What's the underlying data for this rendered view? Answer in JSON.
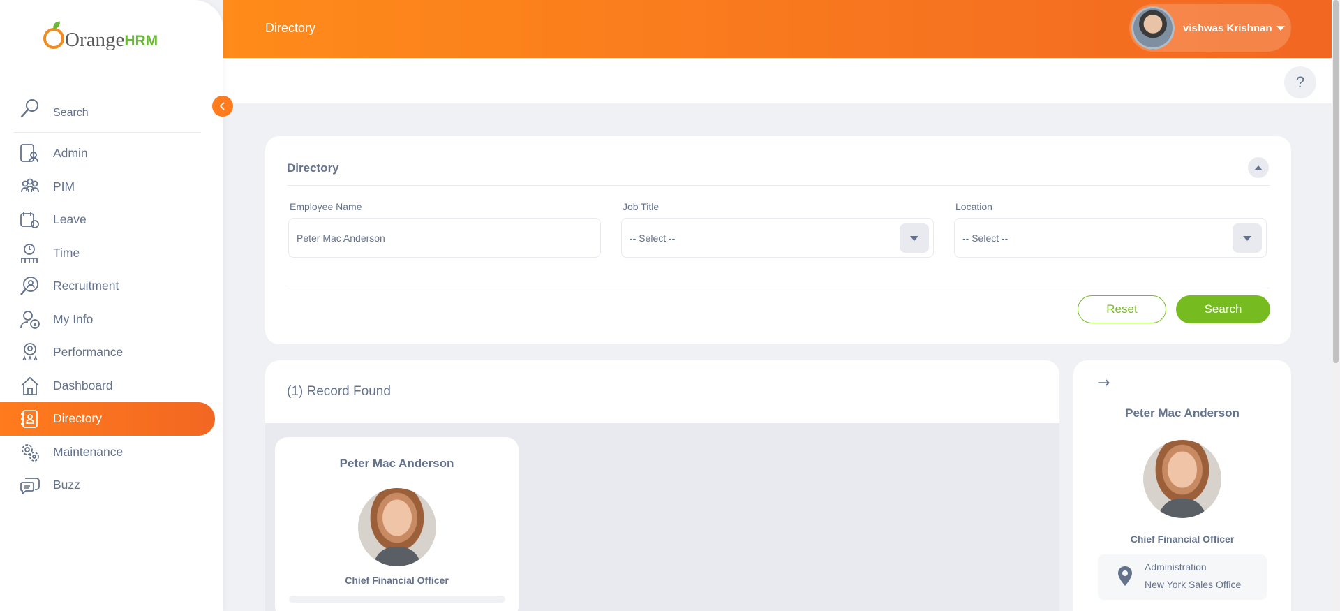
{
  "app": {
    "logo_text": "Orange",
    "logo_suffix": "HRM"
  },
  "header": {
    "title": "Directory",
    "user_name": "vishwas Krishnan",
    "help_label": "?"
  },
  "sidebar": {
    "search_placeholder": "Search",
    "items": [
      {
        "label": "Admin",
        "icon": "admin-icon"
      },
      {
        "label": "PIM",
        "icon": "pim-icon"
      },
      {
        "label": "Leave",
        "icon": "leave-icon"
      },
      {
        "label": "Time",
        "icon": "time-icon"
      },
      {
        "label": "Recruitment",
        "icon": "recruitment-icon"
      },
      {
        "label": "My Info",
        "icon": "my-info-icon"
      },
      {
        "label": "Performance",
        "icon": "performance-icon"
      },
      {
        "label": "Dashboard",
        "icon": "dashboard-icon"
      },
      {
        "label": "Directory",
        "icon": "directory-icon",
        "active": true
      },
      {
        "label": "Maintenance",
        "icon": "maintenance-icon"
      },
      {
        "label": "Buzz",
        "icon": "buzz-icon"
      }
    ]
  },
  "filter": {
    "title": "Directory",
    "employee_name_label": "Employee Name",
    "employee_name_value": "Peter Mac Anderson",
    "job_title_label": "Job Title",
    "job_title_value": "-- Select --",
    "location_label": "Location",
    "location_value": "-- Select --",
    "reset_label": "Reset",
    "search_label": "Search"
  },
  "results": {
    "count_text": "(1) Record Found",
    "cards": [
      {
        "name": "Peter Mac Anderson",
        "job": "Chief Financial Officer"
      }
    ]
  },
  "detail": {
    "arrow": "→",
    "name": "Peter Mac Anderson",
    "job": "Chief Financial Officer",
    "department": "Administration",
    "location": "New York Sales Office"
  },
  "colors": {
    "accent": "#ff7b1d",
    "green": "#76bc21",
    "text": "#64728c"
  }
}
